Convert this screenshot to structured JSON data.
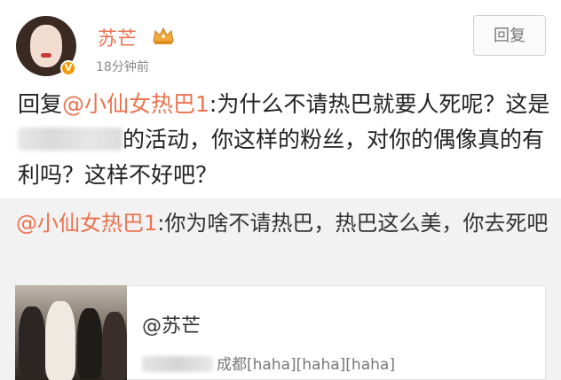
{
  "post": {
    "username": "苏芒",
    "timestamp": "18分钟前",
    "reply_button": "回复",
    "text_prefix": "回复",
    "mention": "@小仙女热巴1",
    "text_part1": ":为什么不请热巴就要人死呢？这是",
    "text_part2": "的活动，你这样的粉丝，对你的偶像真的有利吗？这样不好吧？"
  },
  "quote": {
    "mention": "@小仙女热巴1",
    "text": ":你为啥不请热巴，热巴这么美，你去死吧"
  },
  "card": {
    "title": "@苏芒",
    "subtitle": "成都[haha][haha][haha]"
  },
  "colors": {
    "accent": "#eb7350",
    "quote_bg": "#f2f2f2"
  },
  "icons": {
    "verified": "verified-badge-icon",
    "crown": "crown-icon"
  }
}
